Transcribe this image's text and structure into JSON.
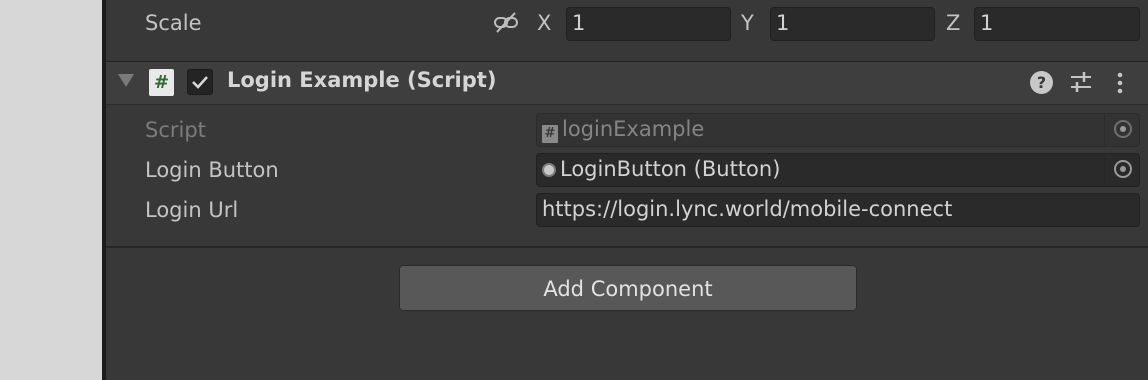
{
  "transform": {
    "scale_label": "Scale",
    "x_label": "X",
    "x_value": "1",
    "y_label": "Y",
    "y_value": "1",
    "z_label": "Z",
    "z_value": "1"
  },
  "component": {
    "title": "Login Example (Script)",
    "enabled": true,
    "icon_glyph": "#",
    "help_glyph": "?"
  },
  "properties": {
    "script_label": "Script",
    "script_value": "loginExample",
    "login_button_label": "Login Button",
    "login_button_value": "LoginButton (Button)",
    "login_url_label": "Login Url",
    "login_url_value": "https://login.lync.world/mobile-connect"
  },
  "add_component_label": "Add Component",
  "colors": {
    "panel_bg": "#383838",
    "header_bg": "#3e3e3e",
    "field_bg": "#2a2a2a",
    "button_bg": "#585858",
    "script_icon_green": "#2f6b2f"
  }
}
